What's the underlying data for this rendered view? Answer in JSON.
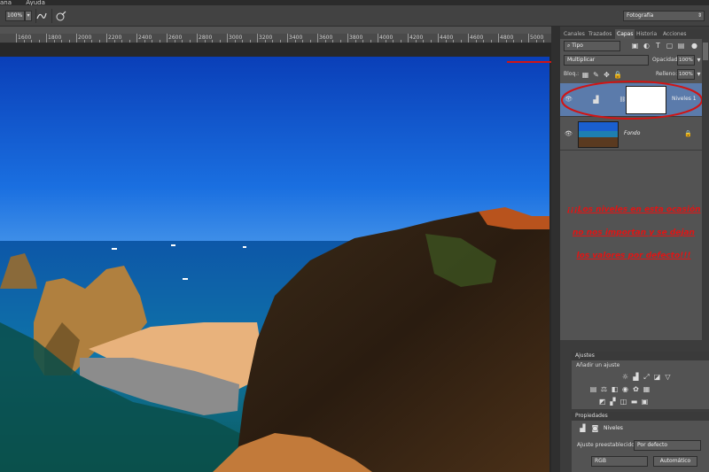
{
  "menubar": {
    "items": [
      "ana",
      "Ayuda"
    ]
  },
  "options": {
    "zoom_value": "100%",
    "workspace": "Fotografía"
  },
  "ruler": {
    "labels": [
      "1600",
      "1800",
      "2000",
      "2200",
      "2400",
      "2600",
      "2800",
      "3000",
      "3200",
      "3400",
      "3600",
      "3800",
      "4000",
      "4200",
      "4400",
      "4600",
      "4800",
      "5000"
    ]
  },
  "panel_tabs": [
    "Canales",
    "Trazados",
    "Capas",
    "Historia",
    "Acciones"
  ],
  "active_tab": "Capas",
  "layers_panel": {
    "filter_label": "Tipo",
    "blend_mode": "Multiplicar",
    "opacity_label": "Opacidad:",
    "opacity_value": "100%",
    "lock_label": "Bloq.:",
    "fill_label": "Relleno:",
    "fill_value": "100%",
    "layers": [
      {
        "name": "Niveles 1",
        "visible": true,
        "selected": true
      },
      {
        "name": "Fondo",
        "visible": true,
        "selected": false
      }
    ]
  },
  "annotation": {
    "line1": "¡¡¡Los niveles en esta ocasión",
    "line2": "no nos importan y se dejan",
    "line3": "los valores por defecto!!!",
    "color": "#e01515"
  },
  "adjustments_panel": {
    "title": "Ajustes",
    "add_label": "Añadir un ajuste"
  },
  "properties_panel": {
    "title": "Propiedades",
    "layer_type": "Niveles",
    "preset_label": "Ajuste preestablecido:",
    "preset_value": "Por defecto",
    "channel": "RGB",
    "auto_button": "Automático"
  }
}
